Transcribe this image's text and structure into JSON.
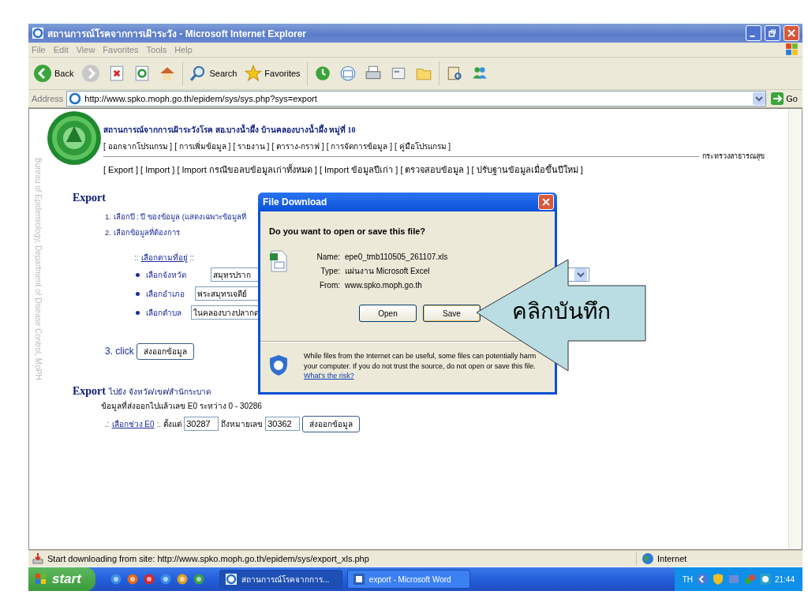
{
  "window": {
    "title": "สถานการณ์โรคจากการเฝ้าระวัง - Microsoft Internet Explorer"
  },
  "menu": [
    "File",
    "Edit",
    "View",
    "Favorites",
    "Tools",
    "Help"
  ],
  "toolbar": [
    {
      "kind": "back",
      "label": "Back"
    },
    {
      "kind": "forward"
    },
    {
      "kind": "stop"
    },
    {
      "kind": "refresh"
    },
    {
      "kind": "home"
    },
    {
      "kind": "search",
      "label": "Search"
    },
    {
      "kind": "favorites",
      "label": "Favorites"
    },
    {
      "kind": "history"
    },
    {
      "kind": "mail"
    },
    {
      "kind": "print"
    },
    {
      "kind": "edit"
    },
    {
      "kind": "folder"
    },
    {
      "kind": "research"
    },
    {
      "kind": "messenger"
    }
  ],
  "address": {
    "label": "Address",
    "url": "http://www.spko.moph.go.th/epidem/sys/sys.php?sys=export",
    "go": "Go"
  },
  "page": {
    "side_text": "Bureau of Epidemiology, Department of Disease Control, MoPH",
    "site_title": "สถานการณ์จากการเฝ้าระวังโรค สอ.บางน้ำผึ้ง บ้านคลองบางน้ำผึ้ง หมู่ที่ 10",
    "nav_links": [
      "[ ออกจากโปรแกรม ]",
      "[ การเพิ่มข้อมูล ]",
      "[ รายงาน ]",
      "[ ตาราง-กราฟ ]",
      "[ การจัดการข้อมูล ]",
      "[ คู่มือโปรแกรม ]"
    ],
    "ministry": "กระทรวงสาธารณสุข",
    "sub_links": [
      "[ Export ]",
      "[ Import ]",
      "[ Import กรณีขอลบข้อมูลเก่าทั้งหมด ]",
      "[ Import ข้อมูลปีเก่า ]",
      "[ ตรวจสอบข้อมูล ]",
      "[ ปรับฐานข้อมูลเมื่อขึ้นปีใหม่ ]"
    ],
    "export": {
      "heading": "Export",
      "step1": "1. เลือกปี : ปี ของข้อมูล (แสดงเฉพาะข้อมูลที่",
      "step2": "2. เลือกข้อมูลที่ต้องการ",
      "filter_prefix": "::",
      "filter_link": "เลือกตามที่อยู่",
      "filter_suffix": "::",
      "fields": [
        {
          "label": "เลือกจังหวัด",
          "value": "สมุทรปราก"
        },
        {
          "label": "เลือกอำเภอ",
          "value": "พระสมุทรเจดีย์"
        },
        {
          "label": "เลือกตำบล",
          "value": "ในคลองบางปลากด"
        }
      ],
      "step3": "3. click",
      "button": "ส่งออกข้อมูล"
    },
    "export2": {
      "heading": "Export",
      "subheading": "ไปยัง จังหวัด/เขต/สำนักระบาด",
      "info": "ข้อมูลที่ส่งออกไปแล้วเลข E0 ระหว่าง 0 - 30286",
      "range_prefix": ".:",
      "range_link": "เลือกช่วง E0",
      "range_suffix": ":.",
      "from_label": "ตั้งแต่",
      "from": "30287",
      "to_label": "ถึงหมายเลข",
      "to": "30362",
      "button": "ส่งออกข้อมูล"
    }
  },
  "dialog": {
    "title": "File Download",
    "question": "Do you want to open or save this file?",
    "rows": [
      {
        "label": "Name:",
        "value": "epe0_tmb110505_261107.xls"
      },
      {
        "label": "Type:",
        "value": "แผ่นงาน Microsoft Excel"
      },
      {
        "label": "From:",
        "value": "www.spko.moph.go.th"
      }
    ],
    "buttons": [
      "Open",
      "Save"
    ],
    "warning": "While files from the Internet can be useful, some files can potentially harm your computer. If you do not trust the source, do not open or save this file.",
    "link": "What's the risk?"
  },
  "callout": {
    "text": "คลิกบันทึก"
  },
  "status_bar": {
    "text": "Start downloading from site: http://www.spko.moph.go.th/epidem/sys/export_xls.php",
    "zone": "Internet"
  },
  "taskbar": {
    "start": "start",
    "tasks": [
      {
        "label": "สถานการณ์โรคจากการ...",
        "kind": "ie",
        "selected": true
      },
      {
        "label": "export - Microsoft Word",
        "kind": "word",
        "selected": false
      }
    ],
    "language": "TH",
    "time": "21:44"
  }
}
